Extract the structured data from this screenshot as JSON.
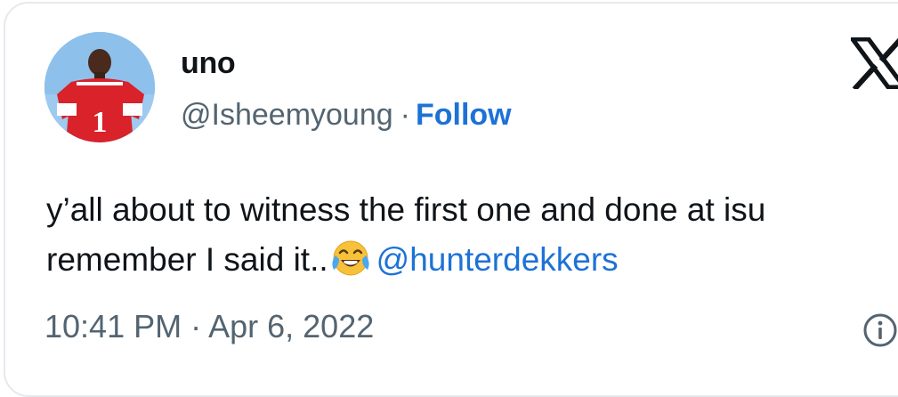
{
  "user": {
    "display_name": "uno",
    "handle": "@Isheemyoung",
    "separator": "·",
    "follow_label": "Follow"
  },
  "tweet": {
    "line1": "y’all about to witness the first one and done at isu",
    "line2": "remember I said it..",
    "emoji": "face-with-tears-of-joy",
    "mention": "@hunterdekkers"
  },
  "meta": {
    "timestamp": "10:41 PM · Apr 6, 2022"
  },
  "icons": {
    "brand": "x-logo",
    "info": "info-icon"
  },
  "colors": {
    "link": "#1d72d6",
    "secondary_text": "#536471",
    "avatar_bg": "#7fb3e6",
    "jersey": "#d9222a"
  }
}
